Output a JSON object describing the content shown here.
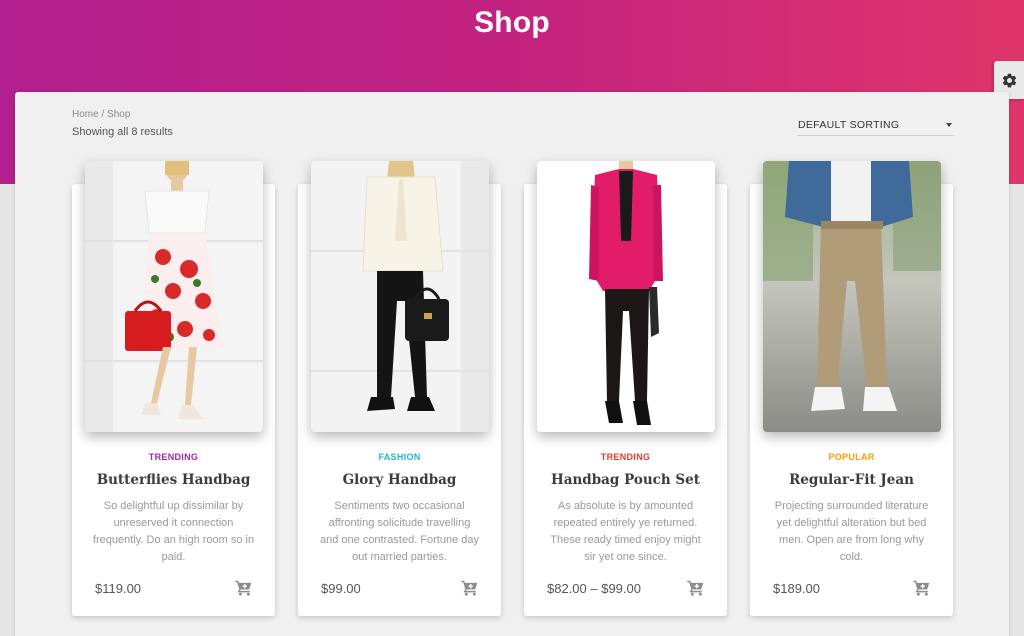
{
  "header": {
    "title": "Shop"
  },
  "breadcrumb": {
    "home": "Home",
    "separator": " / ",
    "current": "Shop"
  },
  "results": {
    "text": "Showing all 8 results"
  },
  "sorting": {
    "selected": "DEFAULT SORTING"
  },
  "products": [
    {
      "category": "TRENDING",
      "category_color": "#9b27b0",
      "name": "Butterflies Handbag",
      "description": "So delightful up dissimilar by unreserved it connection frequently. Do an high room so in paid.",
      "price": "$119.00"
    },
    {
      "category": "FASHION",
      "category_color": "#1fb8cd",
      "name": "Glory Handbag",
      "description": "Sentiments two occasional affronting solicitude travelling and one contrasted. Fortune day out married parties.",
      "price": "$99.00"
    },
    {
      "category": "TRENDING",
      "category_color": "#e53935",
      "name": "Handbag Pouch Set",
      "description": "As absolute is by amounted repeated entirely ye returned. These ready timed enjoy might sir yet one since.",
      "price": "$82.00 – $99.00"
    },
    {
      "category": "POPULAR",
      "category_color": "#f5a000",
      "name": "Regular-Fit Jean",
      "description": "Projecting surrounded literature yet delightful alteration but bed men. Open are from long why cold.",
      "price": "$189.00"
    }
  ],
  "icons": {
    "settings": "gear-icon",
    "add_to_cart": "cart-plus-icon",
    "sort_dropdown": "caret-down-icon"
  }
}
